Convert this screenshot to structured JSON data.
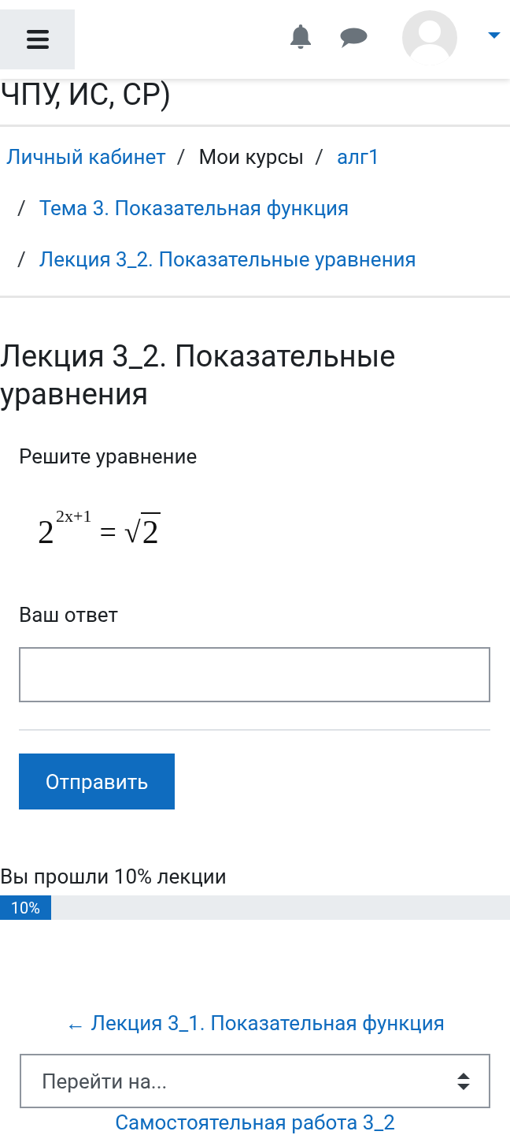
{
  "course_title": "ЧПУ, ИС, СР)",
  "breadcrumb": [
    {
      "label": "Личный кабинет",
      "kind": "link"
    },
    {
      "separator": "/",
      "label": "Мои курсы",
      "kind": "text"
    },
    {
      "separator": "/",
      "label": "алг1",
      "kind": "link"
    },
    {
      "separator": "/",
      "label": "Тема 3. Показательная функция",
      "kind": "link"
    },
    {
      "separator": "/",
      "label": "Лекция 3_2. Показательные уравнения",
      "kind": "link"
    }
  ],
  "page_title": "Лекция 3_2. Показательные уравнения",
  "question": {
    "prompt": "Решите уравнение",
    "equation": {
      "base": "2",
      "exponent": "2x+1",
      "relation": "=",
      "radical": "√",
      "radicand": "2"
    },
    "answer_label": "Ваш ответ",
    "submit_button": "Отправить"
  },
  "progress": {
    "label": "Вы прошли 10% лекции",
    "level": 0.1,
    "value_text": "10%"
  },
  "navigation": {
    "previous_link": "← Лекция 3_1. Показательная функция",
    "jump_select": {
      "value": "Перейти на..."
    },
    "next_link": "Самостоятельная работа 3_2"
  }
}
